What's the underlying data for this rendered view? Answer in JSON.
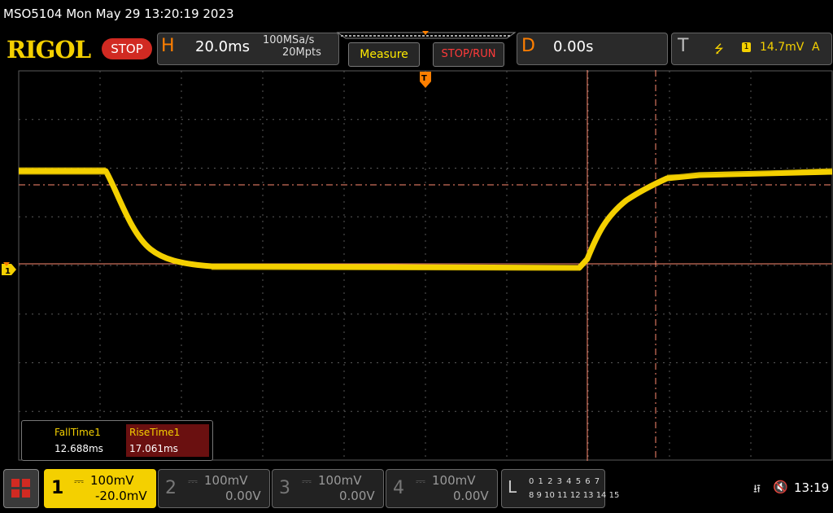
{
  "header": {
    "title_line": "MSO5104  Mon May 29 13:20:19 2023",
    "logo": "RIGOL",
    "run_state": "STOP"
  },
  "horizontal": {
    "letter": "H",
    "timebase": "20.0ms",
    "sample_rate": "100MSa/s",
    "memory_depth": "20Mpts"
  },
  "buttons": {
    "measure": "Measure",
    "stop_run": "STOP/RUN"
  },
  "delay": {
    "letter": "D",
    "value": "0.00s"
  },
  "trigger": {
    "letter": "T",
    "edge_symbol": "⭍",
    "channel": "1",
    "level": "14.7mV",
    "mode": "A",
    "marker": "T"
  },
  "measurements": {
    "fall_label": "FallTime1",
    "fall_value": "12.688ms",
    "rise_label": "RiseTime1",
    "rise_value": "17.061ms"
  },
  "channels": [
    {
      "num": "1",
      "scale": "100mV",
      "offset": "-20.0mV"
    },
    {
      "num": "2",
      "scale": "100mV",
      "offset": "0.00V"
    },
    {
      "num": "3",
      "scale": "100mV",
      "offset": "0.00V"
    },
    {
      "num": "4",
      "scale": "100mV",
      "offset": "0.00V"
    }
  ],
  "logic": {
    "letter": "L",
    "row1": "0 1 2 3  4 5 6 7",
    "row2": "8 9 10 11 12 13 14 15"
  },
  "status": {
    "time": "13:19",
    "usb_icon": "⭿",
    "speaker_icon": "🔇"
  },
  "colors": {
    "ch1": "#f4d000",
    "cursor": "#ff8a70",
    "grid": "#5a5a5a"
  }
}
